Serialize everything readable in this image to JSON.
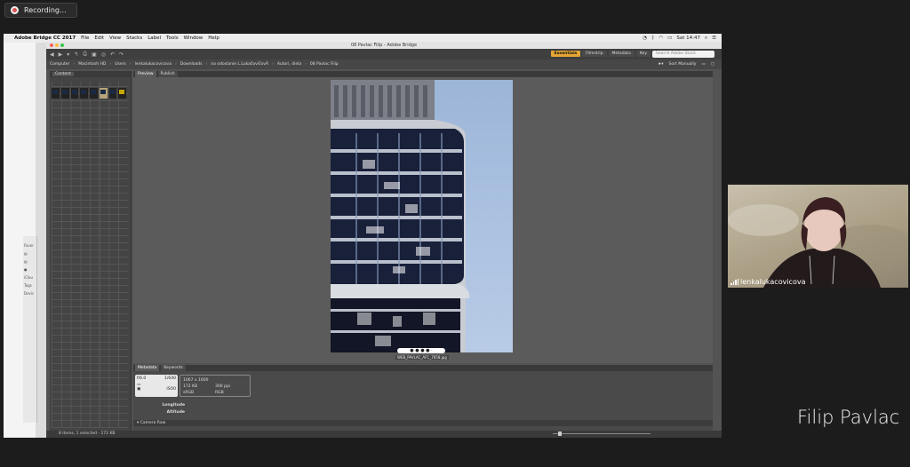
{
  "recording": {
    "label": "Recording..."
  },
  "mac_menubar": {
    "app_name": "Adobe Bridge CC 2017",
    "items": [
      "File",
      "Edit",
      "View",
      "Stacks",
      "Label",
      "Tools",
      "Window",
      "Help"
    ],
    "clock": "Sat 14:47"
  },
  "bridge": {
    "window_title": "08 Pavlac Filip - Adobe Bridge",
    "workspaces": [
      "Essentials",
      "Filmstrip",
      "Metadata",
      "Key"
    ],
    "active_workspace": "Essentials",
    "search_placeholder": "Search Adobe Stock",
    "path": [
      "Computer",
      "Macintosh HD",
      "Users",
      "lenkalukacovicova",
      "Downloads",
      "na odoslanie L.LukačovičovÁ",
      "Autori, diela",
      "08 Pavlac Filip"
    ],
    "sort_label": "Sort Manually",
    "content_tab": "Content",
    "preview_tabs": [
      "Preview",
      "Publish"
    ],
    "filename": "WEB_PAVLAC_AFC_7658.jpg",
    "meta_tabs": [
      "Metadata",
      "Keywords"
    ],
    "meta_left": {
      "aperture": "f/6.0",
      "shutter": "1/640",
      "iso": "ISO0"
    },
    "meta_right": {
      "dimensions": "1067 x 1600",
      "size": "172 KB",
      "res": "300 ppi",
      "color": "sRGB",
      "mode": "RGB"
    },
    "meta_rows": [
      "Longitude",
      "Altitude"
    ],
    "camera_raw": "Camera Raw",
    "status": "8 items, 1 selected - 172 KB"
  },
  "webcam": {
    "username": "lenkalukacovicova"
  },
  "presenter": {
    "name": "Filip Pavlac"
  }
}
